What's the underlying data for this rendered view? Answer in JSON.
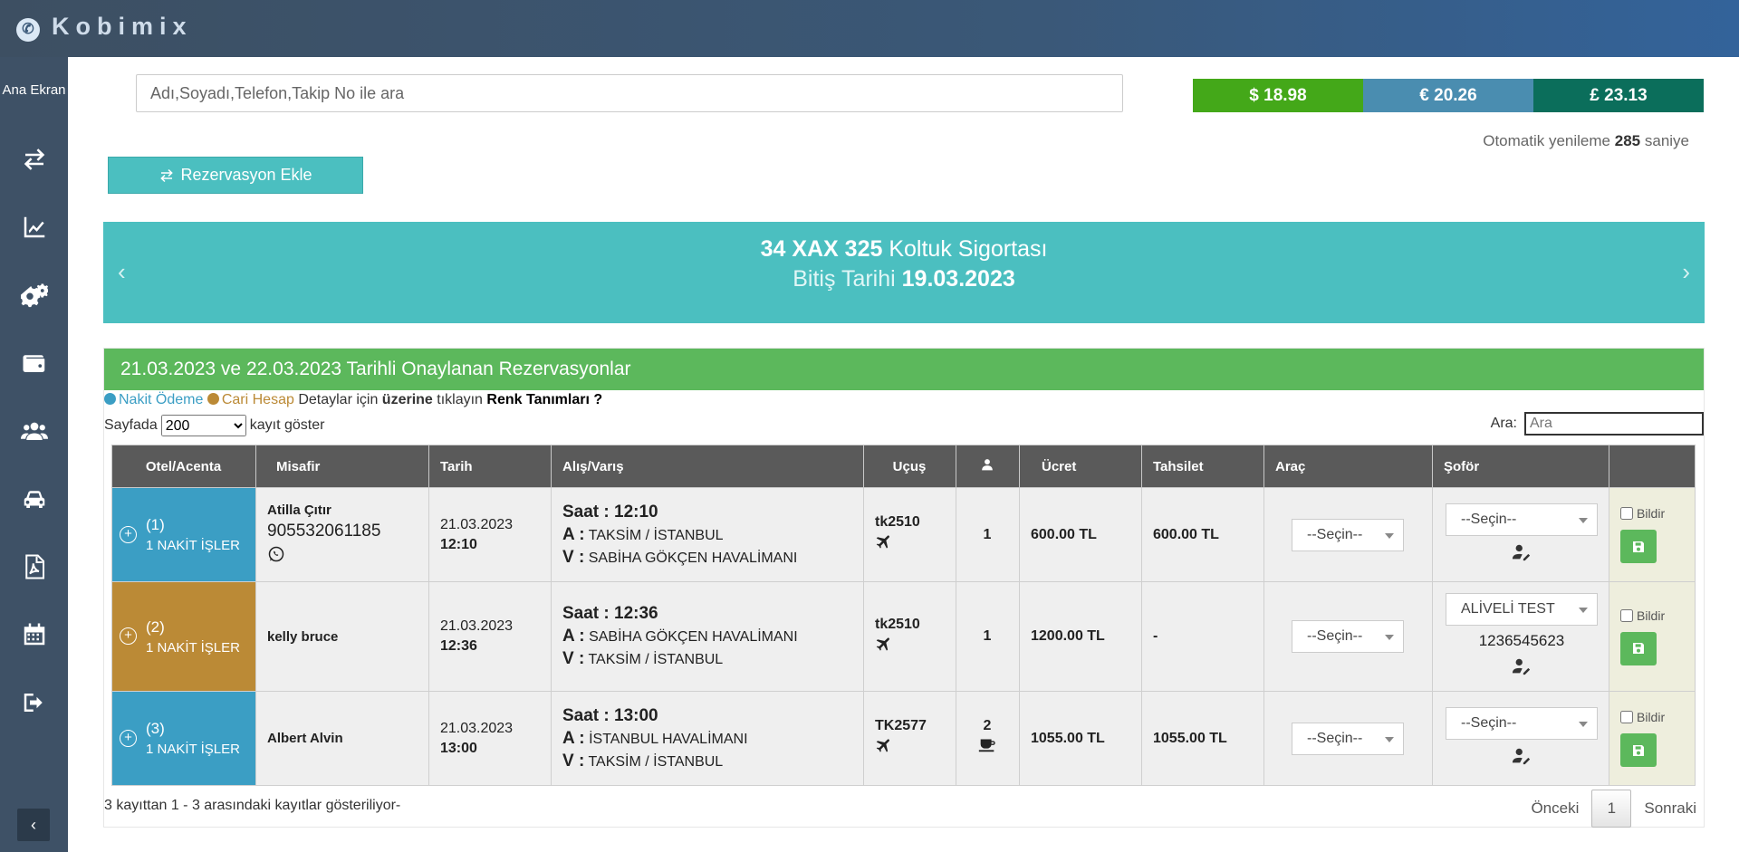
{
  "app": {
    "name": "Kobimix"
  },
  "sidebar": {
    "home_label": "Ana Ekran",
    "collapse_symbol": "‹"
  },
  "search": {
    "placeholder": "Adı,Soyadı,Telefon,Takip No ile ara"
  },
  "rates": [
    {
      "label": "$ 18.98",
      "color": "#44a819"
    },
    {
      "label": "€ 20.26",
      "color": "#4a8db0"
    },
    {
      "label": "£ 23.13",
      "color": "#0b6e5b"
    }
  ],
  "refresh": {
    "prefix": "Otomatik yenileme",
    "seconds": "285",
    "suffix": "saniye"
  },
  "add_button": {
    "label": "Rezervasyon Ekle"
  },
  "banner": {
    "plate": "34 XAX 325",
    "title": "Koltuk Sigortası",
    "date_label": "Bitiş Tarihi",
    "date": "19.03.2023"
  },
  "panel": {
    "title": "21.03.2023 ve 22.03.2023 Tarihli Onaylanan Rezervasyonlar",
    "legend": {
      "cash": "Nakit Ödeme",
      "account": "Cari Hesap",
      "details_pre": "Detaylar için",
      "details_bold": "üzerine",
      "details_post": "tıklayın",
      "colors_link": "Renk Tanımları ?"
    },
    "page_size": {
      "prefix": "Sayfada",
      "value": "200",
      "suffix": "kayıt göster"
    },
    "filter": {
      "label": "Ara:",
      "placeholder": "Ara"
    }
  },
  "table": {
    "headers": [
      "Otel/Acenta",
      "Misafir",
      "Tarih",
      "Alış/Varış",
      "Uçuş",
      "",
      "Ücret",
      "Tahsilet",
      "Araç",
      "Şoför",
      ""
    ],
    "labels": {
      "time": "Saat :",
      "from": "A :",
      "to": "V :",
      "notify": "Bildir"
    },
    "rows": [
      {
        "no": "(1)",
        "agency": "1 NAKİT İŞLER",
        "guest": "Atilla Çıtır",
        "phone": "905532061185",
        "date": "21.03.2023",
        "time": "12:10",
        "saat": "12:10",
        "from": "TAKSİM / İSTANBUL",
        "to": "SABİHA GÖKÇEN HAVALİMANI",
        "flight": "tk2510",
        "pax": "1",
        "fee": "600.00 TL",
        "collected": "600.00 TL",
        "vehicle": "--Seçin--",
        "driver": "--Seçin--",
        "driver_phone": ""
      },
      {
        "no": "(2)",
        "agency": "1 NAKİT İŞLER",
        "guest": "kelly bruce",
        "phone": "",
        "date": "21.03.2023",
        "time": "12:36",
        "saat": "12:36",
        "from": "SABİHA GÖKÇEN HAVALİMANI",
        "to": "TAKSİM / İSTANBUL",
        "flight": "tk2510",
        "pax": "1",
        "fee": "1200.00 TL",
        "collected": "-",
        "vehicle": "--Seçin--",
        "driver": "ALİVELİ TEST",
        "driver_phone": "1236545623"
      },
      {
        "no": "(3)",
        "agency": "1 NAKİT İŞLER",
        "guest": "Albert Alvin",
        "phone": "",
        "date": "21.03.2023",
        "time": "13:00",
        "saat": "13:00",
        "from": "İSTANBUL HAVALİMANI",
        "to": "TAKSİM / İSTANBUL",
        "flight": "TK2577",
        "pax": "2",
        "fee": "1055.00 TL",
        "collected": "1055.00 TL",
        "vehicle": "--Seçin--",
        "driver": "--Seçin--",
        "driver_phone": ""
      }
    ],
    "row_colors": [
      "#3b9ec4",
      "#bb8a36",
      "#3b9ec4"
    ]
  },
  "footer": {
    "info": "3 kayıttan 1 - 3 arasındaki kayıtlar gösteriliyor-",
    "prev": "Önceki",
    "page": "1",
    "next": "Sonraki"
  }
}
